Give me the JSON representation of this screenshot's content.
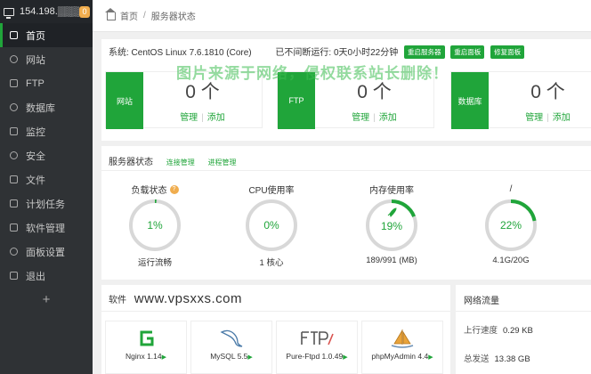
{
  "sidebar": {
    "ip": "154.198.▒▒▒▒▒",
    "badge": "0",
    "items": [
      {
        "label": "首页"
      },
      {
        "label": "网站"
      },
      {
        "label": "FTP"
      },
      {
        "label": "数据库"
      },
      {
        "label": "监控"
      },
      {
        "label": "安全"
      },
      {
        "label": "文件"
      },
      {
        "label": "计划任务"
      },
      {
        "label": "软件管理"
      },
      {
        "label": "面板设置"
      },
      {
        "label": "退出"
      }
    ],
    "add": "+"
  },
  "breadcrumb": {
    "home": "首页",
    "sep": "/",
    "current": "服务器状态"
  },
  "system": {
    "os": "系统: CentOS Linux 7.6.1810 (Core)",
    "uptime": "已不间断运行: 0天0小时22分钟",
    "buttons": [
      "重启服务器",
      "重启面板",
      "修复面板"
    ]
  },
  "watermark": "图片来源于网络，侵权联系站长删除！",
  "stats": [
    {
      "tag": "网站",
      "count": "0 个",
      "manage": "管理",
      "add": "添加"
    },
    {
      "tag": "FTP",
      "count": "0 个",
      "manage": "管理",
      "add": "添加"
    },
    {
      "tag": "数据库",
      "count": "0 个",
      "manage": "管理",
      "add": "添加"
    }
  ],
  "server_status": {
    "title": "服务器状态",
    "links": [
      "连接管理",
      "进程管理"
    ],
    "gauges": [
      {
        "title": "负载状态",
        "help": "?",
        "value": "1%",
        "percent": 1,
        "bottom": "运行流畅"
      },
      {
        "title": "CPU使用率",
        "value": "0%",
        "percent": 0,
        "bottom": "1 核心"
      },
      {
        "title": "内存使用率",
        "value": "19%",
        "percent": 19,
        "bottom": "189/991 (MB)"
      },
      {
        "title": "/",
        "value": "22%",
        "percent": 22,
        "bottom": "4.1G/20G"
      }
    ]
  },
  "software": {
    "title": "软件",
    "site": "www.vpsxxs.com",
    "items": [
      {
        "name": "Nginx 1.14",
        "play": "▶"
      },
      {
        "name": "MySQL 5.5",
        "play": "▶"
      },
      {
        "name": "Pure-Ftpd 1.0.49",
        "play": "▶"
      },
      {
        "name": "phpMyAdmin 4.4",
        "play": "▶"
      }
    ]
  },
  "network": {
    "title": "网络流量",
    "up_label": "上行速度",
    "up_value": "0.29 KB",
    "total_label": "总发送",
    "total_value": "13.38 GB"
  },
  "colors": {
    "accent": "#20a53a",
    "sidebar": "#2f3235",
    "warning": "#f0ad4e",
    "ring": "#d8d8d8"
  }
}
